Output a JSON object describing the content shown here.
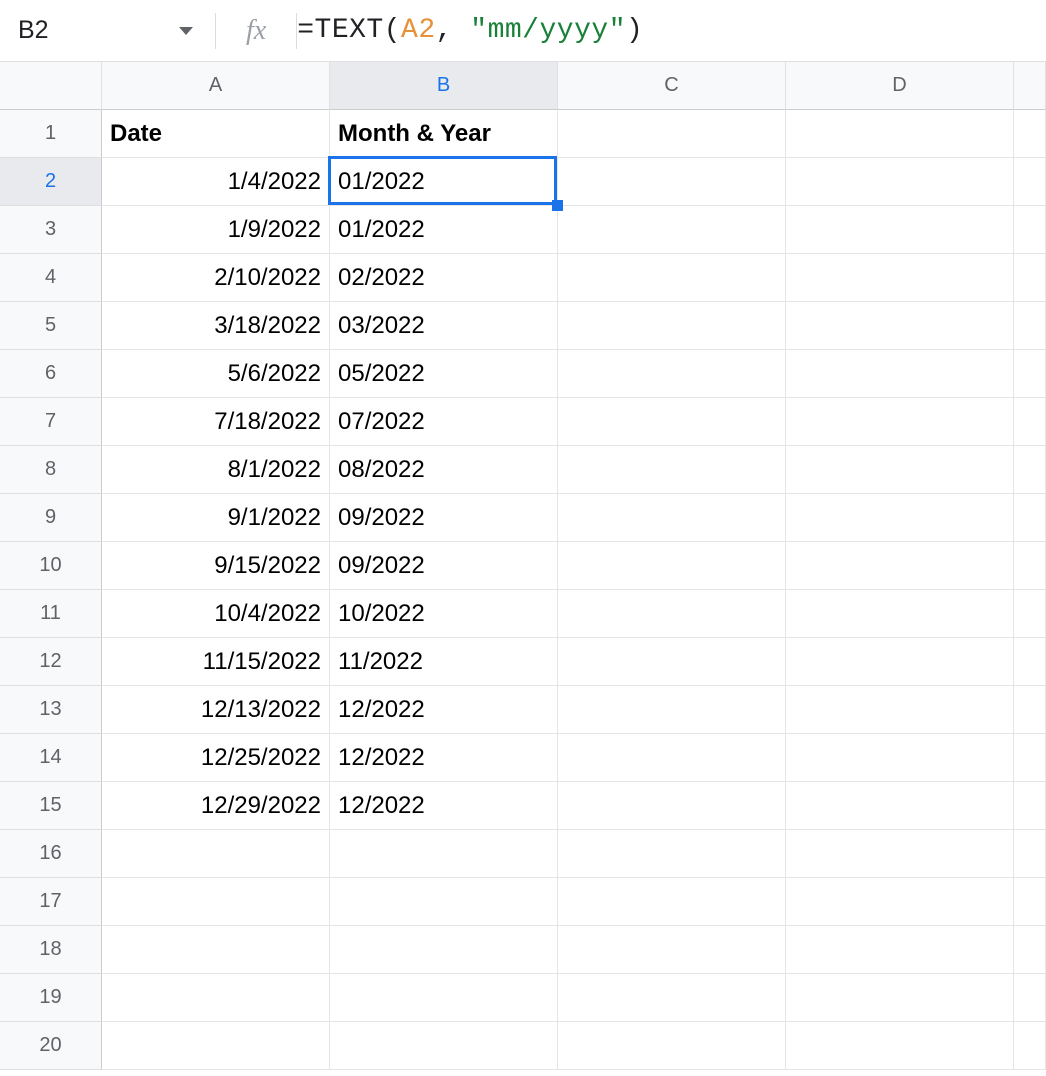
{
  "formula_bar": {
    "cell_ref": "B2",
    "fx_label": "fx",
    "formula_tokens": [
      {
        "cls": "tok-func",
        "text": "=TEXT"
      },
      {
        "cls": "tok-paren",
        "text": "("
      },
      {
        "cls": "tok-ref",
        "text": "A2"
      },
      {
        "cls": "tok-comma",
        "text": ", "
      },
      {
        "cls": "tok-str",
        "text": "\"mm/yyyy\""
      },
      {
        "cls": "tok-paren",
        "text": ")"
      }
    ]
  },
  "columns": [
    "A",
    "B",
    "C",
    "D",
    ""
  ],
  "selected_column_index": 1,
  "selected_row_index": 1,
  "row_count": 20,
  "headers": {
    "A": "Date",
    "B": "Month & Year"
  },
  "rows": [
    {
      "A": "1/4/2022",
      "B": "01/2022"
    },
    {
      "A": "1/9/2022",
      "B": "01/2022"
    },
    {
      "A": "2/10/2022",
      "B": "02/2022"
    },
    {
      "A": "3/18/2022",
      "B": "03/2022"
    },
    {
      "A": "5/6/2022",
      "B": "05/2022"
    },
    {
      "A": "7/18/2022",
      "B": "07/2022"
    },
    {
      "A": "8/1/2022",
      "B": "08/2022"
    },
    {
      "A": "9/1/2022",
      "B": "09/2022"
    },
    {
      "A": "9/15/2022",
      "B": "09/2022"
    },
    {
      "A": "10/4/2022",
      "B": "10/2022"
    },
    {
      "A": "11/15/2022",
      "B": "11/2022"
    },
    {
      "A": "12/13/2022",
      "B": "12/2022"
    },
    {
      "A": "12/25/2022",
      "B": "12/2022"
    },
    {
      "A": "12/29/2022",
      "B": "12/2022"
    }
  ],
  "active_cell": {
    "col": "B",
    "row": 2
  }
}
